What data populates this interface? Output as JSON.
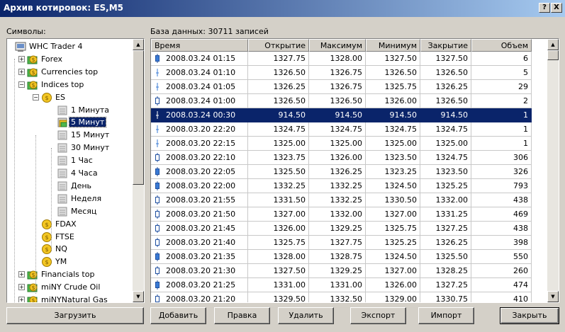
{
  "window": {
    "title": "Архив котировок: ES,M5",
    "help_label": "?",
    "close_label": "X"
  },
  "symbols_label": "Символы:",
  "db_label": "База данных: 30711 записей",
  "tree": [
    {
      "label": "WHC Trader 4",
      "icon": "server-icon",
      "level": 0,
      "toggle": ""
    },
    {
      "label": "Forex",
      "icon": "folder-coin-icon",
      "level": 1,
      "toggle": "+"
    },
    {
      "label": "Currencies top",
      "icon": "folder-coin-icon",
      "level": 1,
      "toggle": "+"
    },
    {
      "label": "Indices top",
      "icon": "folder-coin-icon",
      "level": 1,
      "toggle": "−"
    },
    {
      "label": "ES",
      "icon": "coin-icon",
      "level": 2,
      "toggle": "−"
    },
    {
      "label": "1 Минута",
      "icon": "database-icon",
      "level": 3,
      "toggle": ""
    },
    {
      "label": "5 Минут",
      "icon": "database-active-icon",
      "level": 3,
      "toggle": "",
      "selected": true
    },
    {
      "label": "15 Минут",
      "icon": "database-icon",
      "level": 3,
      "toggle": ""
    },
    {
      "label": "30 Минут",
      "icon": "database-icon",
      "level": 3,
      "toggle": ""
    },
    {
      "label": "1 Час",
      "icon": "database-icon",
      "level": 3,
      "toggle": ""
    },
    {
      "label": "4 Часа",
      "icon": "database-icon",
      "level": 3,
      "toggle": ""
    },
    {
      "label": "День",
      "icon": "database-icon",
      "level": 3,
      "toggle": ""
    },
    {
      "label": "Неделя",
      "icon": "database-icon",
      "level": 3,
      "toggle": ""
    },
    {
      "label": "Месяц",
      "icon": "database-icon",
      "level": 3,
      "toggle": ""
    },
    {
      "label": "FDAX",
      "icon": "coin-icon",
      "level": 2,
      "toggle": ""
    },
    {
      "label": "FTSE",
      "icon": "coin-icon",
      "level": 2,
      "toggle": ""
    },
    {
      "label": "NQ",
      "icon": "coin-icon",
      "level": 2,
      "toggle": ""
    },
    {
      "label": "YM",
      "icon": "coin-icon",
      "level": 2,
      "toggle": ""
    },
    {
      "label": "Financials top",
      "icon": "folder-coin-icon",
      "level": 1,
      "toggle": "+"
    },
    {
      "label": "miNY Crude Oil",
      "icon": "folder-coin-icon",
      "level": 1,
      "toggle": "+"
    },
    {
      "label": "miNYNatural Gas",
      "icon": "folder-coin-icon",
      "level": 1,
      "toggle": "+"
    }
  ],
  "table": {
    "columns": [
      "Время",
      "Открытие",
      "Максимум",
      "Минимум",
      "Закрытие",
      "Объем"
    ],
    "rows": [
      {
        "cells": [
          "2008.03.24 01:15",
          "1327.75",
          "1328.00",
          "1327.50",
          "1327.50",
          "6"
        ],
        "candle": "bull"
      },
      {
        "cells": [
          "2008.03.24 01:10",
          "1326.50",
          "1326.75",
          "1326.50",
          "1326.50",
          "5"
        ],
        "candle": "doji"
      },
      {
        "cells": [
          "2008.03.24 01:05",
          "1326.25",
          "1326.75",
          "1325.75",
          "1326.25",
          "29"
        ],
        "candle": "doji"
      },
      {
        "cells": [
          "2008.03.24 01:00",
          "1326.50",
          "1326.50",
          "1326.00",
          "1326.50",
          "2"
        ],
        "candle": "bear"
      },
      {
        "cells": [
          "2008.03.24 00:30",
          "914.50",
          "914.50",
          "914.50",
          "914.50",
          "1"
        ],
        "candle": "doji",
        "selected": true
      },
      {
        "cells": [
          "2008.03.20 22:20",
          "1324.75",
          "1324.75",
          "1324.75",
          "1324.75",
          "1"
        ],
        "candle": "doji"
      },
      {
        "cells": [
          "2008.03.20 22:15",
          "1325.00",
          "1325.00",
          "1325.00",
          "1325.00",
          "1"
        ],
        "candle": "doji"
      },
      {
        "cells": [
          "2008.03.20 22:10",
          "1323.75",
          "1326.00",
          "1323.50",
          "1324.75",
          "306"
        ],
        "candle": "bear"
      },
      {
        "cells": [
          "2008.03.20 22:05",
          "1325.50",
          "1326.25",
          "1323.25",
          "1323.50",
          "326"
        ],
        "candle": "bull"
      },
      {
        "cells": [
          "2008.03.20 22:00",
          "1332.25",
          "1332.25",
          "1324.50",
          "1325.25",
          "793"
        ],
        "candle": "bull"
      },
      {
        "cells": [
          "2008.03.20 21:55",
          "1331.50",
          "1332.25",
          "1330.50",
          "1332.00",
          "438"
        ],
        "candle": "bear"
      },
      {
        "cells": [
          "2008.03.20 21:50",
          "1327.00",
          "1332.00",
          "1327.00",
          "1331.25",
          "469"
        ],
        "candle": "bear"
      },
      {
        "cells": [
          "2008.03.20 21:45",
          "1326.00",
          "1329.25",
          "1325.75",
          "1327.25",
          "438"
        ],
        "candle": "bear"
      },
      {
        "cells": [
          "2008.03.20 21:40",
          "1325.75",
          "1327.75",
          "1325.25",
          "1326.25",
          "398"
        ],
        "candle": "bear"
      },
      {
        "cells": [
          "2008.03.20 21:35",
          "1328.00",
          "1328.75",
          "1324.50",
          "1325.50",
          "550"
        ],
        "candle": "bull"
      },
      {
        "cells": [
          "2008.03.20 21:30",
          "1327.50",
          "1329.25",
          "1327.00",
          "1328.25",
          "260"
        ],
        "candle": "bear"
      },
      {
        "cells": [
          "2008.03.20 21:25",
          "1331.00",
          "1331.00",
          "1326.00",
          "1327.25",
          "474"
        ],
        "candle": "bull"
      },
      {
        "cells": [
          "2008.03.20 21:20",
          "1329.50",
          "1332.50",
          "1329.00",
          "1330.75",
          "410"
        ],
        "candle": "bear"
      }
    ]
  },
  "buttons": {
    "load": "Загрузить",
    "add": "Добавить",
    "edit": "Правка",
    "delete": "Удалить",
    "export": "Экспорт",
    "import": "Импорт",
    "close": "Закрыть"
  },
  "colors": {
    "selection": "#0a246a",
    "candle_bull": "#3a7bd5",
    "face": "#d4d0c8"
  }
}
